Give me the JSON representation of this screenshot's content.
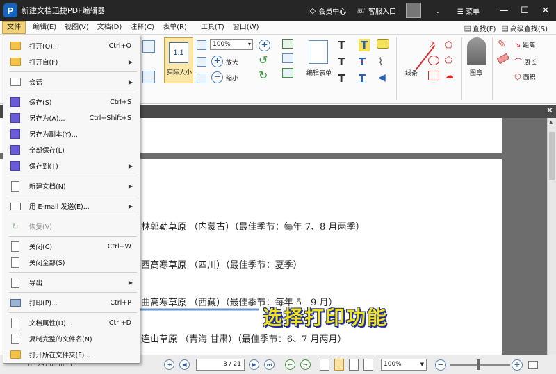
{
  "window": {
    "title": "新建文档迅捷PDF编辑器",
    "logo_letter": "P",
    "member_center": "会员中心",
    "customer_service": "客服入口",
    "menu_label": "菜单",
    "dot": "."
  },
  "menubar": {
    "items": [
      "文件",
      "编辑(E)",
      "视图(V)",
      "文档(D)",
      "注释(C)",
      "表单(R)",
      "工具(T)",
      "窗口(W)"
    ],
    "find": "查找(F)",
    "advanced_find": "高级查找(S)"
  },
  "ribbon": {
    "actual_size_icon": "1:1",
    "actual_size": "实际大小",
    "zoom_value": "100%",
    "zoom_in": "放大",
    "zoom_out": "缩小",
    "edit_form": "编辑表单",
    "lines": "线条",
    "stamp": "图章",
    "distance": "距离",
    "perimeter": "周长",
    "area": "面积"
  },
  "file_menu": {
    "items": [
      {
        "label": "打开(O)...",
        "shortcut": "Ctrl+O",
        "icon": "folder-open-icon",
        "submenu": false
      },
      {
        "label": "打开自(F)",
        "shortcut": "",
        "icon": "folder-web-icon",
        "submenu": true
      },
      {
        "label": "会话",
        "shortcut": "",
        "icon": "session-icon",
        "submenu": true
      },
      {
        "label": "保存(S)",
        "shortcut": "Ctrl+S",
        "icon": "save-icon",
        "submenu": false
      },
      {
        "label": "另存为(A)...",
        "shortcut": "Ctrl+Shift+S",
        "icon": "save-as-icon",
        "submenu": false
      },
      {
        "label": "另存为副本(Y)...",
        "shortcut": "",
        "icon": "save-copy-icon",
        "submenu": false
      },
      {
        "label": "全部保存(L)",
        "shortcut": "",
        "icon": "save-all-icon",
        "submenu": false
      },
      {
        "label": "保存到(T)",
        "shortcut": "",
        "icon": "save-to-icon",
        "submenu": true
      },
      {
        "label": "新建文档(N)",
        "shortcut": "",
        "icon": "new-document-icon",
        "submenu": true
      },
      {
        "label": "用 E-mail 发送(E)...",
        "shortcut": "",
        "icon": "email-icon",
        "submenu": true
      },
      {
        "label": "恢复(V)",
        "shortcut": "",
        "icon": "revert-icon",
        "submenu": false,
        "disabled": true
      },
      {
        "label": "关闭(C)",
        "shortcut": "Ctrl+W",
        "icon": "close-document-icon",
        "submenu": false
      },
      {
        "label": "关闭全部(S)",
        "shortcut": "",
        "icon": "close-all-icon",
        "submenu": false
      },
      {
        "label": "导出",
        "shortcut": "",
        "icon": "export-icon",
        "submenu": true
      },
      {
        "label": "打印(P)...",
        "shortcut": "Ctrl+P",
        "icon": "printer-icon",
        "submenu": false
      },
      {
        "label": "文档属性(D)...",
        "shortcut": "Ctrl+D",
        "icon": "document-properties-icon",
        "submenu": false
      },
      {
        "label": "复制完整的文件名(N)",
        "shortcut": "",
        "icon": "copy-filename-icon",
        "submenu": false
      },
      {
        "label": "打开所在文件夹(F)...",
        "shortcut": "",
        "icon": "open-folder-icon",
        "submenu": false
      }
    ]
  },
  "document": {
    "lines": [
      "林郭勒草原 （内蒙古）（最佳季节：每年 7、8 月两季）",
      "西高寒草原 （四川）（最佳季节：夏季）",
      "曲高寒草原 （西藏）（最佳季节：每年 5—9 月）",
      "连山草原 （青海 甘肃）（最佳季节：6、7 月两月）"
    ]
  },
  "annotation": "选择打印功能",
  "statusbar": {
    "dimensions": "H : 297.0mm",
    "y_label": "Y :",
    "page_indicator": "3 / 21",
    "zoom_value": "100%"
  }
}
